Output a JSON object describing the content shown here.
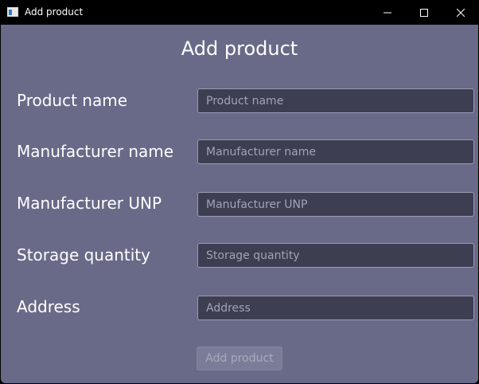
{
  "window": {
    "title": "Add product"
  },
  "form": {
    "heading": "Add product",
    "fields": [
      {
        "label": "Product name",
        "placeholder": "Product name",
        "value": ""
      },
      {
        "label": "Manufacturer name",
        "placeholder": "Manufacturer name",
        "value": ""
      },
      {
        "label": "Manufacturer UNP",
        "placeholder": "Manufacturer UNP",
        "value": ""
      },
      {
        "label": "Storage quantity",
        "placeholder": "Storage quantity",
        "value": ""
      },
      {
        "label": "Address",
        "placeholder": "Address",
        "value": ""
      }
    ],
    "submit_label": "Add product",
    "submit_enabled": false
  },
  "icons": {
    "app": "app-window-icon",
    "minimize": "minimize-icon",
    "maximize": "maximize-icon",
    "close": "close-icon"
  },
  "colors": {
    "background": "#696a88",
    "input_background": "#3d3e51",
    "titlebar": "#000000",
    "text": "#ffffff"
  }
}
